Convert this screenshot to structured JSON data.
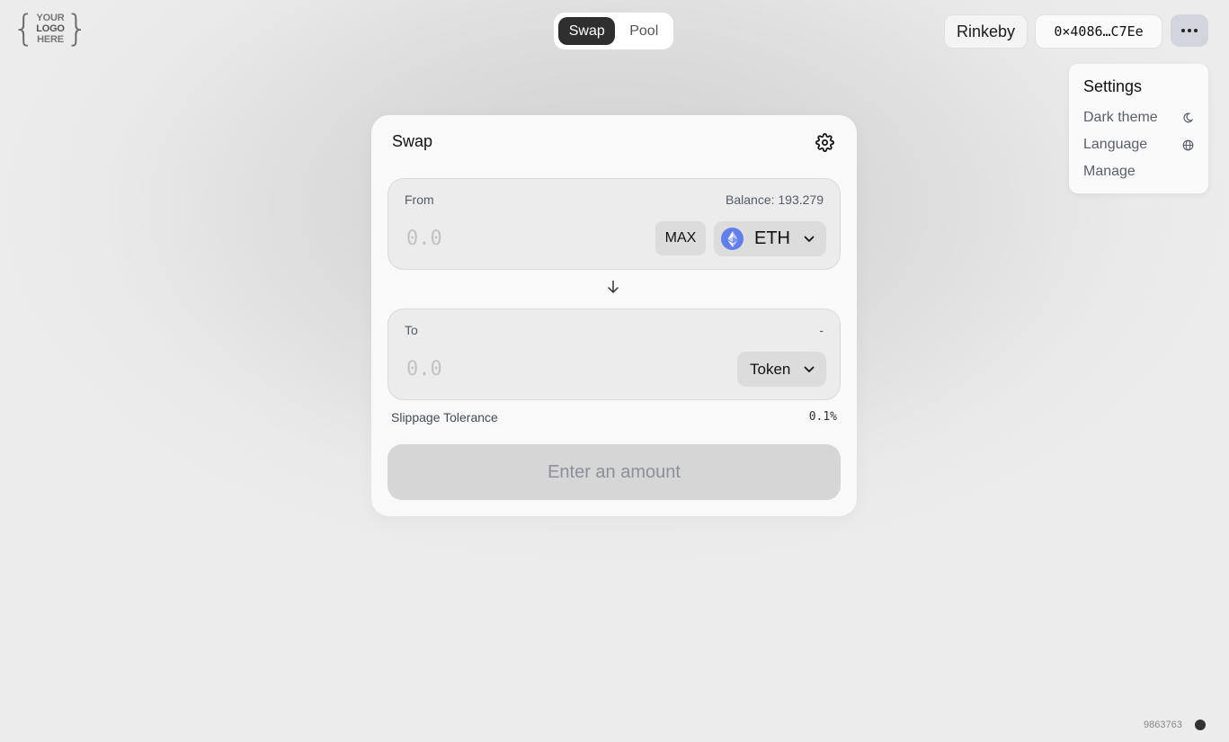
{
  "logo": {
    "brace_left": "{",
    "brace_right": "}",
    "lines": [
      "YOUR",
      "LOGO",
      "HERE"
    ]
  },
  "nav": {
    "tabs": [
      {
        "label": "Swap",
        "active": true
      },
      {
        "label": "Pool",
        "active": false
      }
    ]
  },
  "header": {
    "network": "Rinkeby",
    "account": "0×4086…C7Ee",
    "more_icon": "more-horizontal-icon"
  },
  "settings_menu": {
    "title": "Settings",
    "items": [
      {
        "label": "Dark theme",
        "icon": "moon-icon"
      },
      {
        "label": "Language",
        "icon": "globe-icon"
      },
      {
        "label": "Manage",
        "icon": ""
      }
    ]
  },
  "swap": {
    "title": "Swap",
    "settings_icon": "gear-icon",
    "from": {
      "label": "From",
      "balance": "Balance: 193.279",
      "placeholder": "0.0",
      "max_label": "MAX",
      "token": "ETH",
      "token_icon": "eth-icon"
    },
    "arrow_icon": "arrow-down-icon",
    "to": {
      "label": "To",
      "balance": "-",
      "placeholder": "0.0",
      "token": "Token"
    },
    "slippage": {
      "label": "Slippage Tolerance",
      "value": "0.1%"
    },
    "submit_label": "Enter an amount"
  },
  "footer": {
    "block_number": "9863763"
  },
  "colors": {
    "active_tab": "#2f2f2f",
    "eth_blue": "#627eea",
    "more_button": "#d2d5dc",
    "status_dot": "#333333"
  }
}
